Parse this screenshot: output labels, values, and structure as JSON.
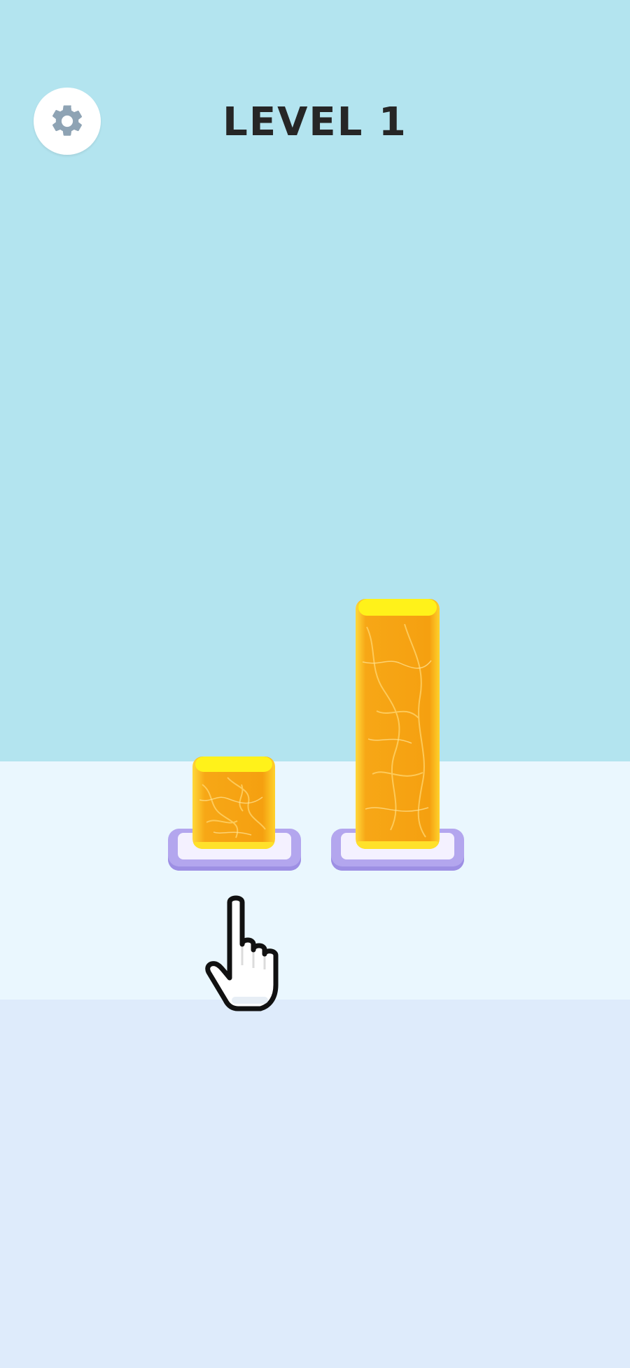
{
  "hud": {
    "level_label": "LEVEL 1",
    "settings_icon": "gear-icon"
  },
  "stacks": [
    {
      "id": "left",
      "block_height_units": 1,
      "selected": false
    },
    {
      "id": "right",
      "block_height_units": 3,
      "selected": false
    }
  ],
  "tutorial": {
    "pointer_icon": "pointing-hand-icon",
    "target_stack": "left"
  },
  "colors": {
    "sky": "#b3e4ef",
    "floor_top": "#eaf7fe",
    "floor_bottom": "#deebfb",
    "block_orange": "#f5a810",
    "block_top_yellow": "#fff21a",
    "pad_purple": "#b3a6ee",
    "title_text": "#262626",
    "gear_icon": "#8ea3b4"
  }
}
